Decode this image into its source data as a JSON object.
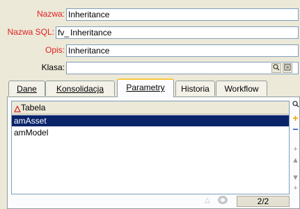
{
  "form": {
    "nazwa_label": "Nazwa:",
    "nazwa_value": "Inheritance",
    "nazwa_sql_label": "Nazwa SQL:",
    "nazwa_sql_prefix": "fv_",
    "nazwa_sql_value": "Inheritance",
    "opis_label": "Opis:",
    "opis_value": "Inheritance",
    "klasa_label": "Klasa:",
    "klasa_value": ""
  },
  "tabs": [
    {
      "label": "Dane"
    },
    {
      "label": "Konsolidacja"
    },
    {
      "label": "Parametry"
    },
    {
      "label": "Historia"
    },
    {
      "label": "Workflow"
    }
  ],
  "active_tab": "Parametry",
  "grid": {
    "column_header": "Tabela",
    "rows": [
      "amAsset",
      "amModel"
    ],
    "selected_row": "amAsset",
    "count": "2/2"
  },
  "colors": {
    "required_label": "#e02020",
    "selection": "#0a246a",
    "add_icon": "#f0a000",
    "remove_icon": "#2050c0"
  },
  "icons": [
    "search-icon",
    "details-icon",
    "sort-icon",
    "add-icon",
    "remove-icon",
    "up-icon",
    "down-icon",
    "filter-icon"
  ]
}
